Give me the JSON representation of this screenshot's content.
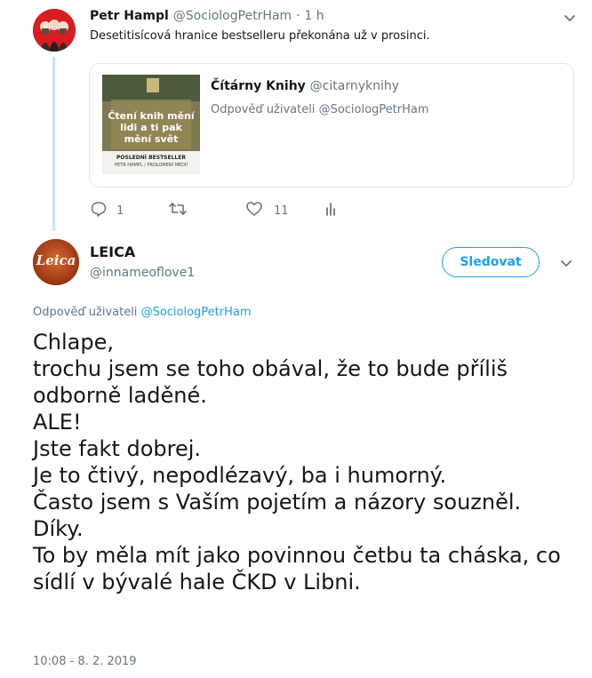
{
  "parent_tweet": {
    "author_name": "Petr Hampl",
    "author_handle": "@SociologPetrHam",
    "separator": "·",
    "time": "1 h",
    "text": "Desetitisícová hranice bestselleru překonána už v prosinci.",
    "quoted": {
      "author_name": "Čítárny Knihy",
      "author_handle": "@citarnyknihy",
      "reply_prefix": "Odpověď uživateli",
      "reply_to": "@SociologPetrHam",
      "thumbnail": {
        "headline": "Čtení knih mění lidi a ti pak mění svět",
        "footer_line1": "POSLEDNÍ BESTSELLER",
        "footer_line2": "PETR HAMPL / PROLOMENÍ MEDIÍ"
      }
    },
    "actions": {
      "reply_count": "1",
      "retweet_count": "",
      "like_count": "11",
      "icons": [
        "reply-icon",
        "retweet-icon",
        "heart-icon",
        "analytics-icon"
      ]
    }
  },
  "main_tweet": {
    "author_name": "LEICA",
    "author_handle": "@innameoflove1",
    "follow_label": "Sledovat",
    "reply_prefix": "Odpověď uživateli",
    "reply_to": "@SociologPetrHam",
    "body": "Chlape,\ntrochu jsem se toho obával, že to bude příliš odborně laděné.\nALE!\nJste fakt dobrej.\nJe to čtivý, nepodlézavý, ba i humorný.\nČasto jsem s Vaším pojetím a názory souzněl.\nDíky.\nTo by měla mít jako povinnou četbu ta cháska, co sídlí v bývalé hale ČKD v Libni.",
    "timestamp": "10:08 - 8. 2. 2019",
    "avatar_logo_text": "Leica"
  },
  "colors": {
    "accent": "#1da1f2",
    "muted": "#657786",
    "thread_line": "#c4e4fb",
    "border": "#e1e8ed"
  }
}
